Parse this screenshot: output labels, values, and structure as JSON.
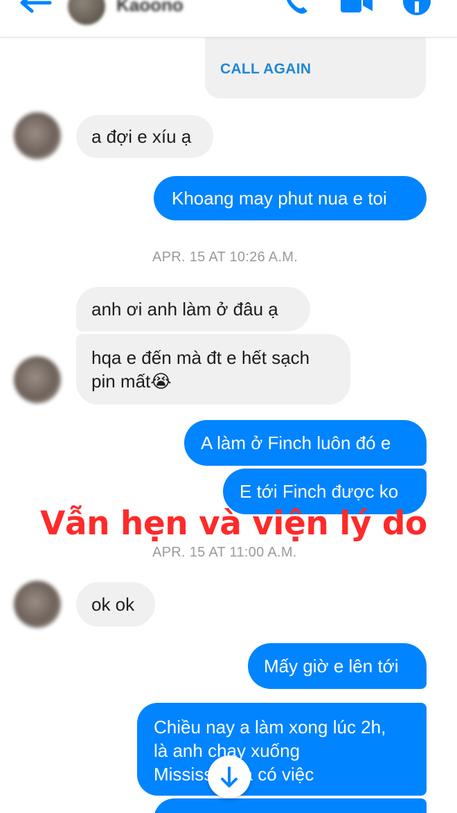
{
  "header": {
    "contact_name": "Kaoono"
  },
  "messages": {
    "call_again": "CALL AGAIN",
    "m1": "a đợi e xíu ạ",
    "m2": "Khoang may phut nua e toi",
    "ts1": "APR. 15 AT 10:26 A.M.",
    "m3": "anh ơi anh làm ở đâu ạ",
    "m4_line1": "hqa e đến mà đt e hết sạch",
    "m4_line2": "pin mất😭",
    "m5": "A làm ở Finch luôn đó e",
    "m6": "E tới Finch được ko",
    "ts2": "APR. 15 AT 11:00 A.M.",
    "m7": "ok ok",
    "m8": "Mấy giờ e lên tới",
    "m9_line1": "Chiều nay a làm xong lúc 2h,",
    "m9_line2": "là anh chạy xuống",
    "m9_line3": "Mississauga có việc"
  },
  "overlay": {
    "caption": "Vẫn hẹn và viện lý do",
    "color": "#ff2a2a"
  },
  "colors": {
    "outgoing_bubble": "#0084ff",
    "incoming_bubble": "#f1f0f0",
    "accent": "#0084ff"
  },
  "icons": [
    "back-arrow-icon",
    "phone-icon",
    "video-camera-icon",
    "info-icon",
    "scroll-down-arrow-icon"
  ]
}
